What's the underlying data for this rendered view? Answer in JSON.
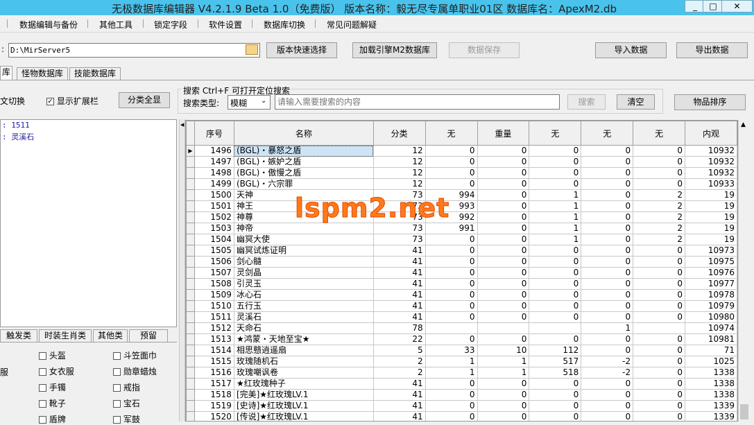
{
  "window": {
    "title": "无极数据库编辑器 V4.2.1.9   Beta 1.0（免费版）   版本名称：毅无尽专属单职业01区    数据库名：ApexM2.db",
    "minimize": "_",
    "maximize": "□",
    "close": "✕"
  },
  "menu": [
    "数据编辑与备份",
    "其他工具",
    "锁定字段",
    "软件设置",
    "数据库切换",
    "常见问题解疑"
  ],
  "toolbar": {
    "path_label": ":",
    "path_value": "D:\\MirServer5",
    "quick_select": "版本快速选择",
    "load_db": "加载引擎M2数据库",
    "save_data": "数据保存",
    "import_data": "导入数据",
    "export_data": "导出数据"
  },
  "tabs": [
    "库",
    "怪物数据库",
    "技能数据库"
  ],
  "options": {
    "switch_label": "文切换",
    "show_ext_label": "显示扩展栏",
    "show_ext_checked": true,
    "show_all_button": "分类全显"
  },
  "search": {
    "title": "搜索   Ctrl+F 可打开定位搜索",
    "type_label": "搜索类型:",
    "type_value": "模糊",
    "placeholder": "请输入需要搜索的内容",
    "search_button": "搜索",
    "clear_button": "清空",
    "sort_button": "物品排序"
  },
  "info": {
    "line1": ": 1511",
    "line2": ": 灵溪石"
  },
  "category_tabs": [
    "触发类",
    "时装生肖类",
    "其他类",
    "预留"
  ],
  "category_checks": [
    {
      "label": "头盔",
      "checked": false
    },
    {
      "label": "斗笠面巾",
      "checked": false
    },
    {
      "label": "女衣服",
      "checked": false
    },
    {
      "label": "勋章蜡烛",
      "checked": false
    },
    {
      "label": "手镯",
      "checked": false
    },
    {
      "label": "戒指",
      "checked": false
    },
    {
      "label": "靴子",
      "checked": false
    },
    {
      "label": "宝石",
      "checked": false
    },
    {
      "label": "盾牌",
      "checked": false
    },
    {
      "label": "军鼓",
      "checked": false
    }
  ],
  "left_partial_label": "服",
  "table": {
    "columns": [
      "序号",
      "名称",
      "分类",
      "无",
      "重量",
      "无",
      "无",
      "无",
      "内观"
    ],
    "rows": [
      [
        "1496",
        "(BGL)・暴怒之盾",
        "12",
        "0",
        "0",
        "0",
        "0",
        "0",
        "10932"
      ],
      [
        "1497",
        "(BGL)・嫉妒之盾",
        "12",
        "0",
        "0",
        "0",
        "0",
        "0",
        "10932"
      ],
      [
        "1498",
        "(BGL)・傲慢之盾",
        "12",
        "0",
        "0",
        "0",
        "0",
        "0",
        "10932"
      ],
      [
        "1499",
        "(BGL)・六宗罪",
        "12",
        "0",
        "0",
        "0",
        "0",
        "0",
        "10933"
      ],
      [
        "1500",
        "天神",
        "73",
        "994",
        "0",
        "1",
        "0",
        "2",
        "19"
      ],
      [
        "1501",
        "神王",
        "73",
        "993",
        "0",
        "1",
        "0",
        "2",
        "19"
      ],
      [
        "1502",
        "神尊",
        "73",
        "992",
        "0",
        "1",
        "0",
        "2",
        "19"
      ],
      [
        "1503",
        "神帝",
        "73",
        "991",
        "0",
        "1",
        "0",
        "2",
        "19"
      ],
      [
        "1504",
        "幽冥大使",
        "73",
        "0",
        "0",
        "1",
        "0",
        "2",
        "19"
      ],
      [
        "1505",
        "幽冥试炼证明",
        "41",
        "0",
        "0",
        "0",
        "0",
        "0",
        "10973"
      ],
      [
        "1506",
        "剑心髓",
        "41",
        "0",
        "0",
        "0",
        "0",
        "0",
        "10975"
      ],
      [
        "1507",
        "灵剑晶",
        "41",
        "0",
        "0",
        "0",
        "0",
        "0",
        "10976"
      ],
      [
        "1508",
        "引灵玉",
        "41",
        "0",
        "0",
        "0",
        "0",
        "0",
        "10977"
      ],
      [
        "1509",
        "冰心石",
        "41",
        "0",
        "0",
        "0",
        "0",
        "0",
        "10978"
      ],
      [
        "1510",
        "五行玉",
        "41",
        "0",
        "0",
        "0",
        "0",
        "0",
        "10979"
      ],
      [
        "1511",
        "灵溪石",
        "41",
        "0",
        "0",
        "0",
        "0",
        "0",
        "10980"
      ],
      [
        "1512",
        "天命石",
        "78",
        "",
        "",
        "",
        "1",
        "",
        "10974"
      ],
      [
        "1513",
        "★鸿蒙・天地至宝★",
        "22",
        "0",
        "0",
        "0",
        "0",
        "0",
        "10981"
      ],
      [
        "1514",
        "相思戆逍遥扇",
        "5",
        "33",
        "10",
        "112",
        "0",
        "0",
        "71"
      ],
      [
        "1515",
        "玫瑰随机石",
        "2",
        "1",
        "1",
        "517",
        "-2",
        "0",
        "1025"
      ],
      [
        "1516",
        "玫瑰嘲讽卷",
        "2",
        "1",
        "1",
        "518",
        "-2",
        "0",
        "1338"
      ],
      [
        "1517",
        "★红玫瑰种子",
        "41",
        "0",
        "0",
        "0",
        "0",
        "0",
        "1338"
      ],
      [
        "1518",
        "[完美]★红玫瑰LV.1",
        "41",
        "0",
        "0",
        "0",
        "0",
        "0",
        "1338"
      ],
      [
        "1519",
        "[史诗]★红玫瑰LV.1",
        "41",
        "0",
        "0",
        "0",
        "0",
        "0",
        "1339"
      ],
      [
        "1520",
        "[传说]★红玫瑰LV.1",
        "41",
        "0",
        "0",
        "0",
        "0",
        "0",
        "1339"
      ]
    ]
  },
  "watermark": "lspm2.net",
  "colors": {
    "titlebar": "#4ac3ec",
    "watermark": "#ff7a1a",
    "selection": "#cde4f7"
  }
}
